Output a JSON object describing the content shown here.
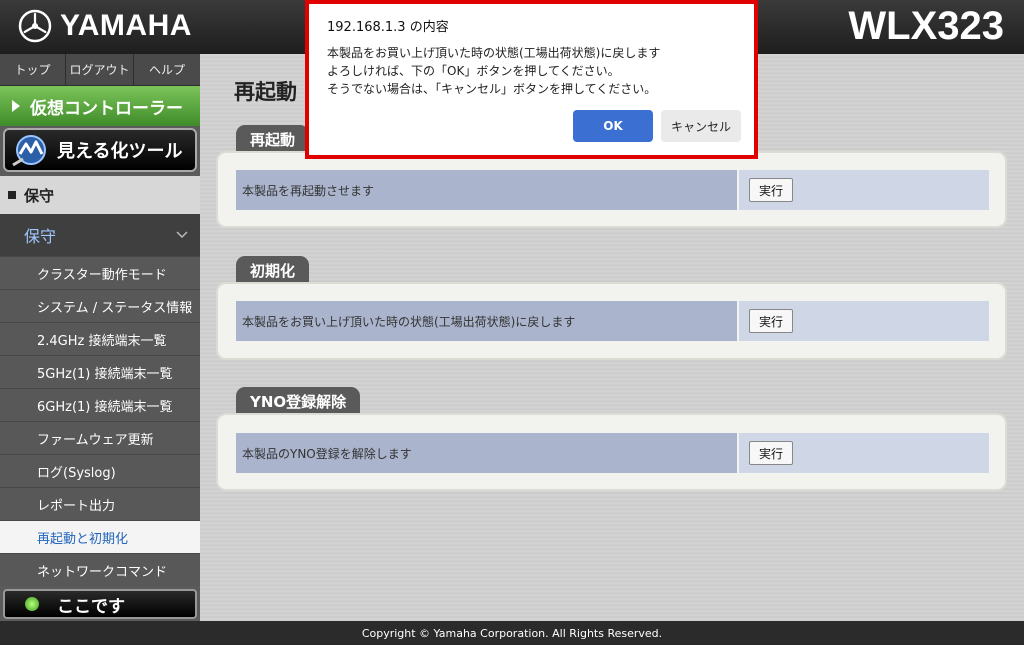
{
  "header": {
    "brand": "YAMAHA",
    "model": "WLX323"
  },
  "sidebar": {
    "topnav": [
      "トップ",
      "ログアウト",
      "ヘルプ"
    ],
    "virtual_controller": "仮想コントローラー",
    "visualization_tool": "見える化ツール",
    "section_header": "保守",
    "submenu_header": "保守",
    "items": [
      "クラスター動作モード",
      "システム / ステータス情報",
      "2.4GHz 接続端末一覧",
      "5GHz(1) 接続端末一覧",
      "6GHz(1) 接続端末一覧",
      "ファームウェア更新",
      "ログ(Syslog)",
      "レポート出力",
      "再起動と初期化",
      "ネットワークコマンド"
    ],
    "active_item": "再起動と初期化",
    "here_button": "ここです"
  },
  "main": {
    "page_title": "再起動",
    "sections": [
      {
        "tab": "再起動",
        "description": "本製品を再起動させます",
        "button": "実行"
      },
      {
        "tab": "初期化",
        "description": "本製品をお買い上げ頂いた時の状態(工場出荷状態)に戻します",
        "button": "実行"
      },
      {
        "tab": "YNO登録解除",
        "description": "本製品のYNO登録を解除します",
        "button": "実行"
      }
    ]
  },
  "footer": {
    "copyright": "Copyright © Yamaha Corporation. All Rights Reserved."
  },
  "dialog": {
    "title": "192.168.1.3 の内容",
    "lines": [
      "本製品をお買い上げ頂いた時の状態(工場出荷状態)に戻します",
      "よろしければ、下の「OK」ボタンを押してください。",
      "そうでない場合は、「キャンセル」ボタンを押してください。"
    ],
    "ok": "OK",
    "cancel": "キャンセル"
  },
  "colors": {
    "accent_green": "#4aa534",
    "dialog_border": "#e00000",
    "ok_button": "#3b6fd1",
    "active_link": "#2266bb"
  }
}
